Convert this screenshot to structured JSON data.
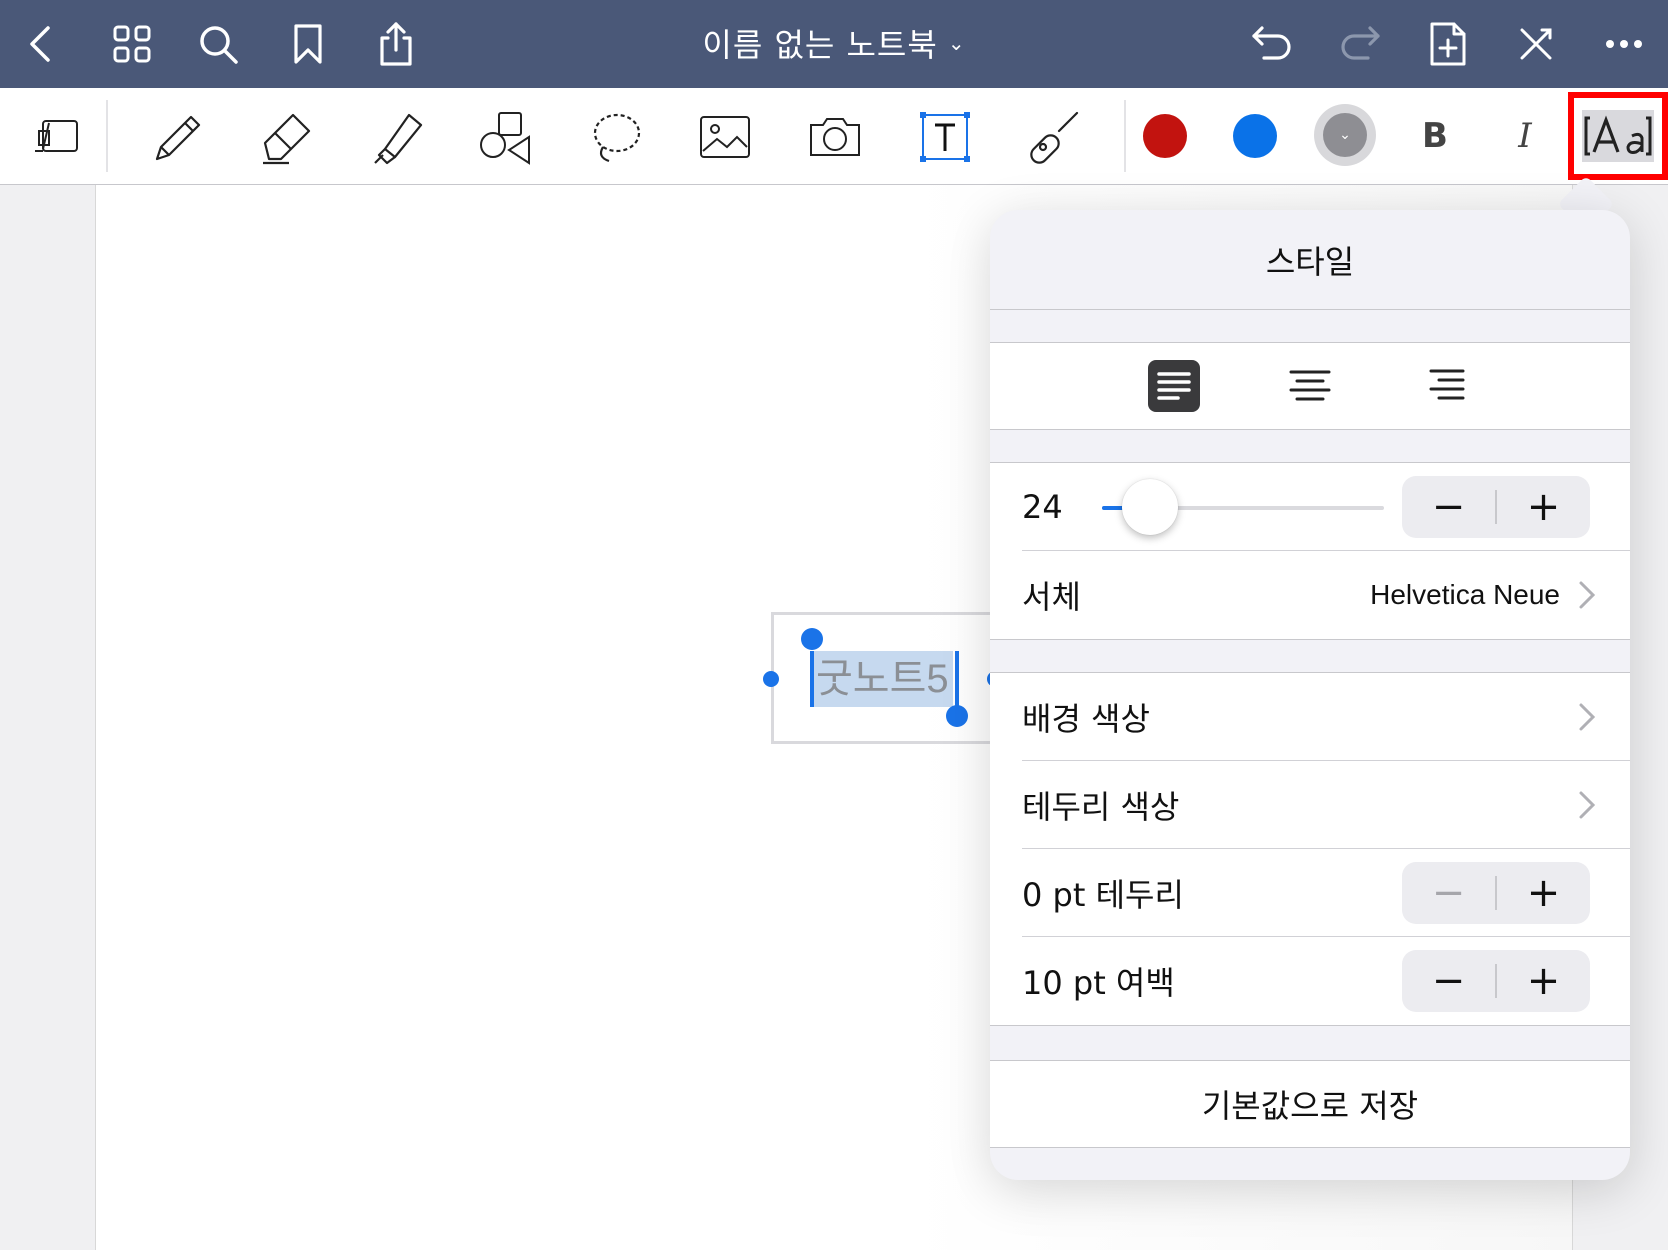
{
  "navbar": {
    "title": "이름 없는 노트북",
    "title_chevron": "⌄",
    "left_icons": [
      "back-icon",
      "grid-icon",
      "search-icon",
      "bookmark-icon",
      "share-icon"
    ],
    "right_icons": [
      "undo-icon",
      "redo-icon",
      "add-page-icon",
      "close-tools-icon",
      "more-icon"
    ]
  },
  "toolbar": {
    "tools": [
      "page-layout-icon",
      "pen-icon",
      "eraser-icon",
      "highlighter-icon",
      "shapes-icon",
      "lasso-icon",
      "image-icon",
      "camera-icon",
      "text-tool-icon",
      "laser-pointer-icon"
    ],
    "active_tool": "text-tool-icon",
    "colors": {
      "red": "#c2130f",
      "blue": "#0a72e8",
      "gray": "#8e8e93"
    },
    "bold_label": "B",
    "italic_label": "I",
    "style_button_icon": "text-style-icon"
  },
  "canvas": {
    "textbox_text": "굿노트5"
  },
  "style_popover": {
    "title": "스타일",
    "alignment": {
      "options": [
        "left",
        "center",
        "right"
      ],
      "selected": "left"
    },
    "font_size": {
      "value": "24",
      "slider_fraction": 0.17
    },
    "font": {
      "label": "서체",
      "value": "Helvetica Neue"
    },
    "background_color": {
      "label": "배경 색상"
    },
    "border_color": {
      "label": "테두리 색상"
    },
    "border_width": {
      "label": "0 pt 테두리"
    },
    "padding": {
      "label": "10 pt 여백"
    },
    "stepper": {
      "minus": "−",
      "plus": "+"
    },
    "save_default": "기본값으로 저장"
  }
}
